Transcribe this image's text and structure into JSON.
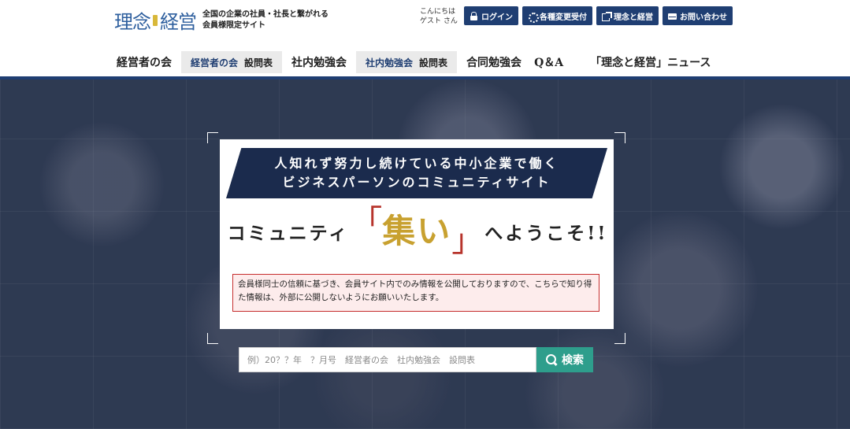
{
  "logo": {
    "text_left": "理念",
    "text_right": "経営",
    "tagline_line1": "全国の企業の社員・社長と繋がれる",
    "tagline_line2": "会員様限定サイト"
  },
  "greeting": {
    "line1": "こんにちは",
    "line2": "ゲスト さん"
  },
  "top_buttons": [
    {
      "label": "ログイン",
      "icon": "lock-icon"
    },
    {
      "label": "各種変更受付",
      "icon": "gear-icon"
    },
    {
      "label": "理念と経営",
      "icon": "external-icon"
    },
    {
      "label": "お問い合わせ",
      "icon": "mail-icon"
    }
  ],
  "nav": {
    "item1": "経営者の会",
    "item2_hl": "経営者の会",
    "item2_rest": "設問表",
    "item3": "社内勉強会",
    "item4_hl": "社内勉強会",
    "item4_rest": "設問表",
    "item5": "合同勉強会",
    "item6": "Q＆A",
    "item7": "「理念と経営」ニュース"
  },
  "hero": {
    "banner_line1": "人知れず努力し続けている中小企業で働く",
    "banner_line2": "ビジネスパーソンのコミュニティサイト",
    "welcome_pre": "コミュニティ",
    "welcome_bracket_left": "「",
    "welcome_mid": "集い",
    "welcome_bracket_right": "」",
    "welcome_post": "へようこそ!!",
    "notice": "会員様同士の信頼に基づき、会員サイト内でのみ情報を公開しておりますので、こちらで知り得た情報は、外部に公開しないようにお願いいたします。"
  },
  "search": {
    "placeholder": "例）20？？年　？月号　経営者の会　社内勉強会　設問表",
    "button_label": "検索"
  },
  "colors": {
    "brand_navy": "#1f3e72",
    "search_teal": "#2e9e8c",
    "accent_gold": "#c8a130",
    "accent_red": "#b7342c"
  }
}
